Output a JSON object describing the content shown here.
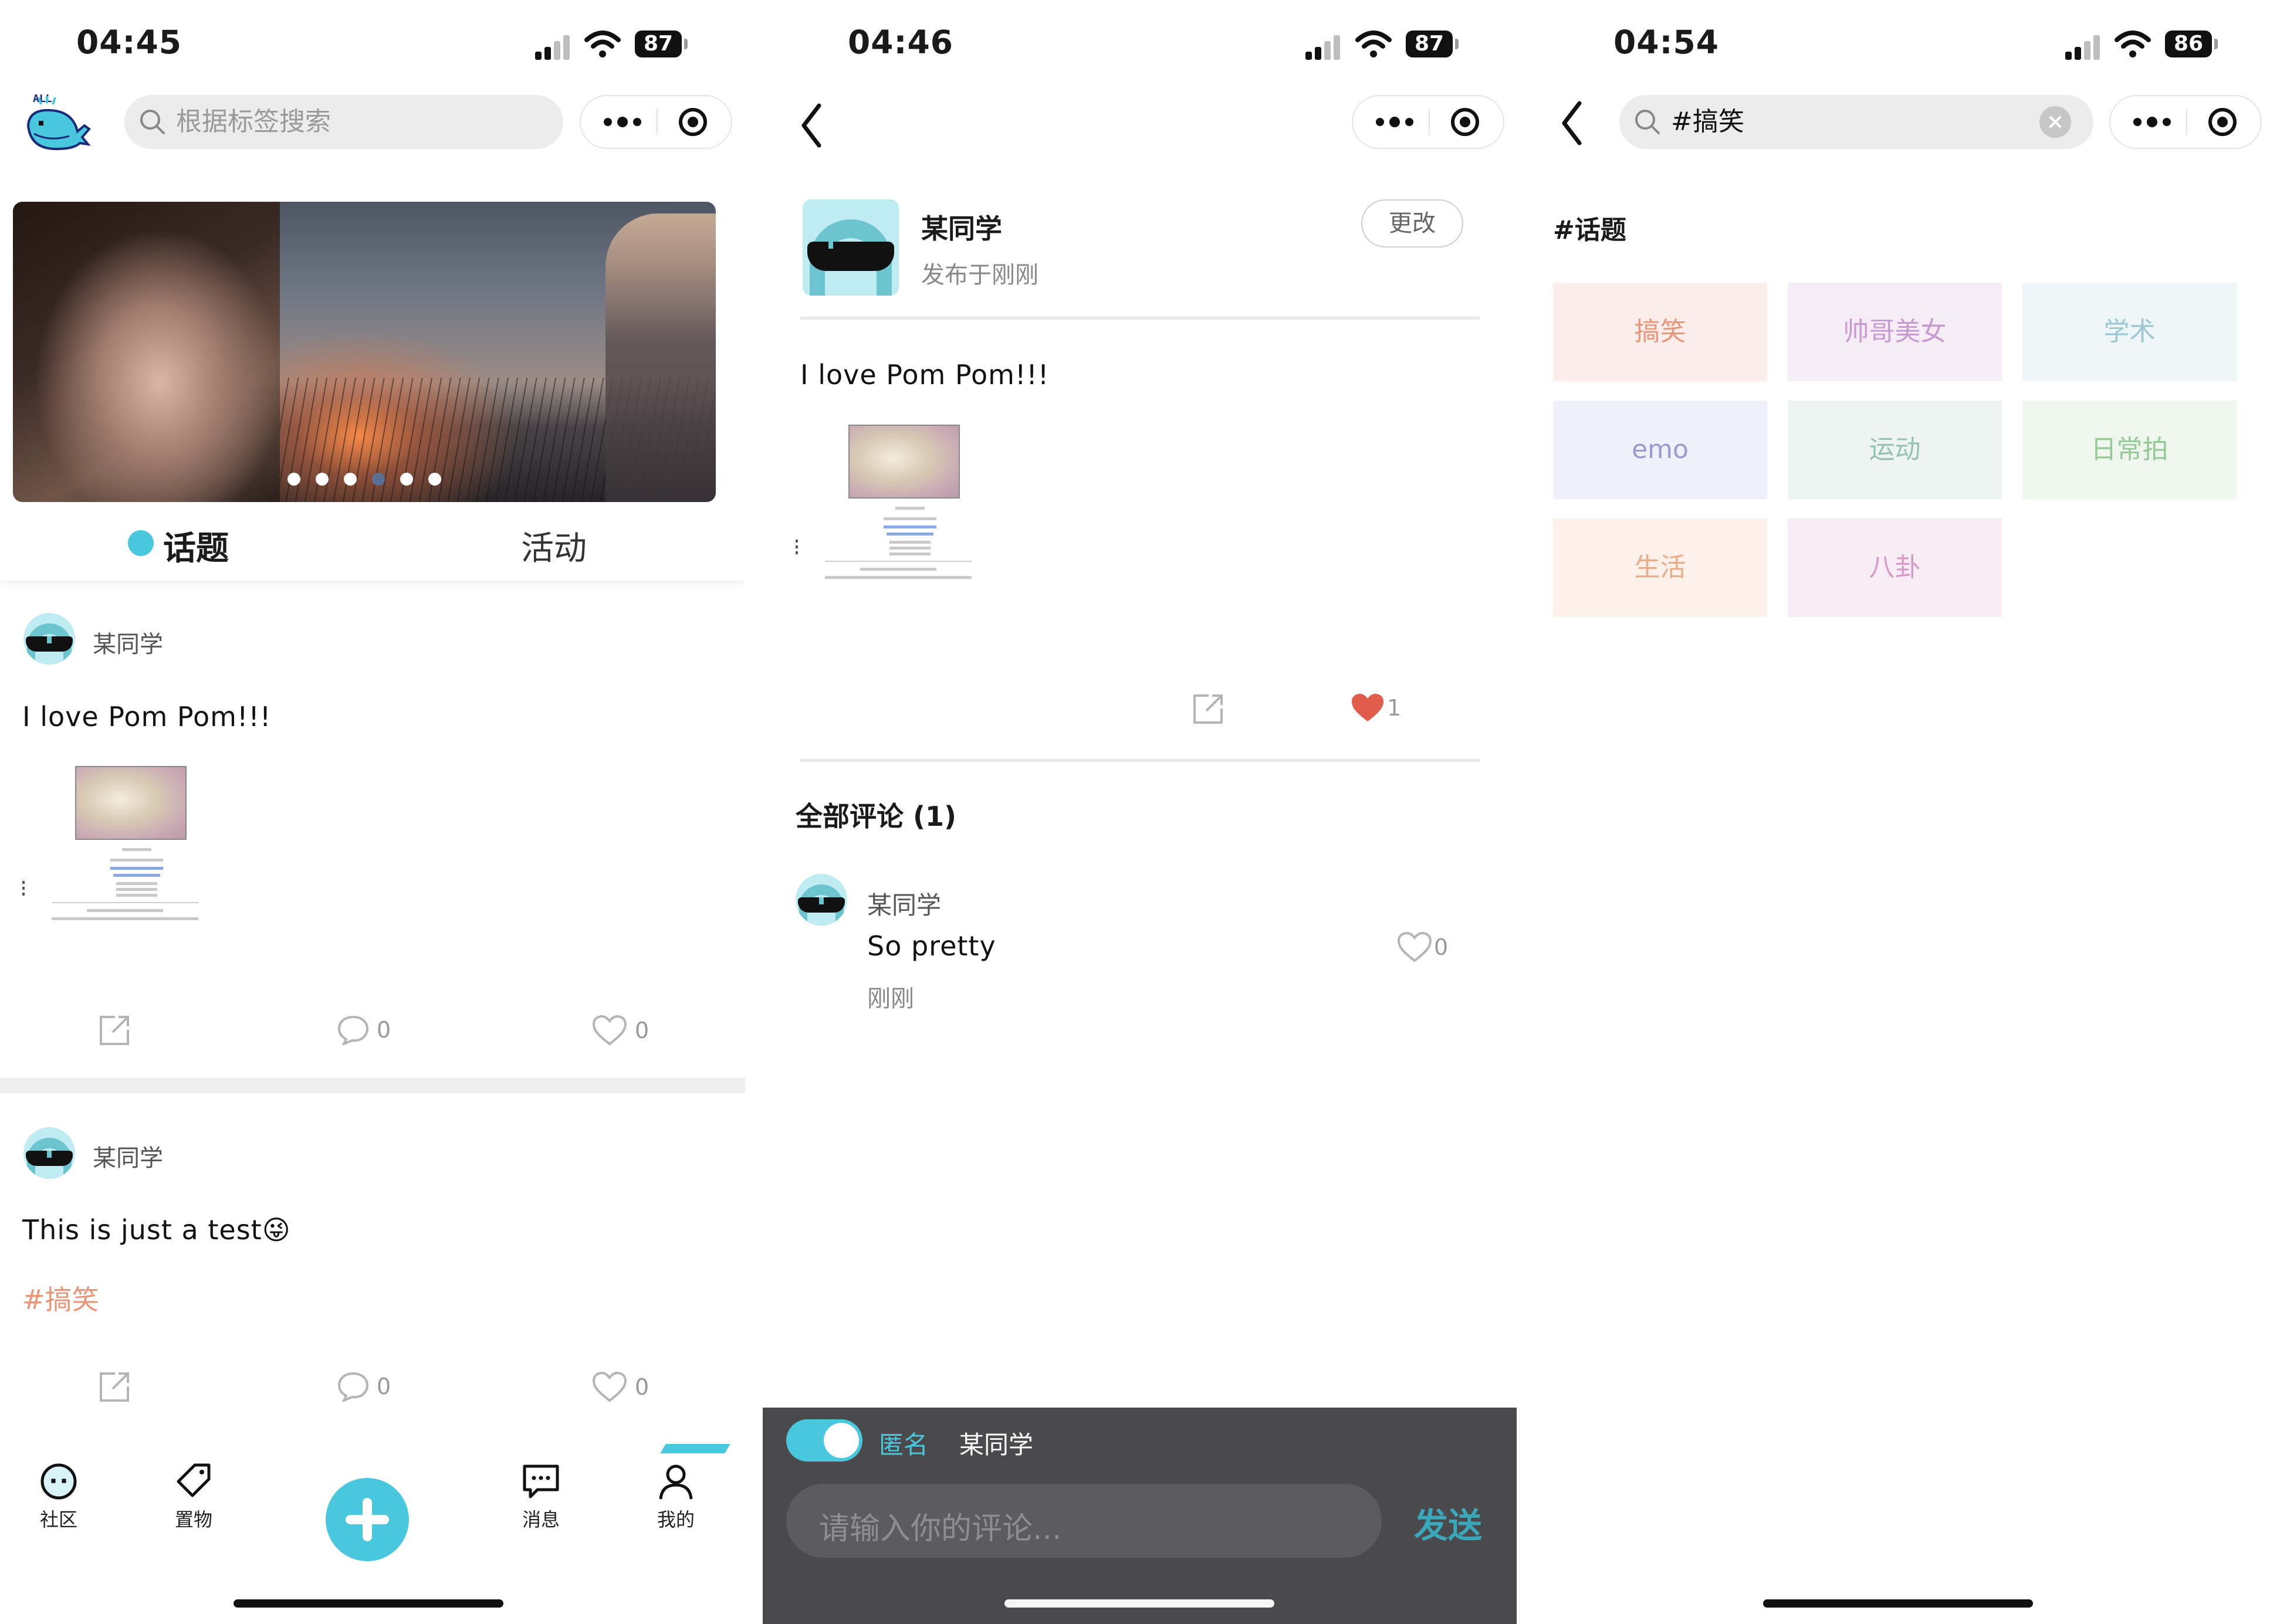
{
  "colors": {
    "accent": "#49c7dc",
    "tag": "#e8967a",
    "heart": "#e05d4b"
  },
  "screen1": {
    "status": {
      "time": "04:45",
      "battery": "87"
    },
    "search_placeholder": "根据标签搜索",
    "tabs": [
      "话题",
      "活动"
    ],
    "posts": [
      {
        "author": "某同学",
        "text": "I love Pom Pom!!!",
        "comments": "0",
        "likes": "0"
      },
      {
        "author": "某同学",
        "text": "This is just a test😜",
        "tag": "#搞笑",
        "comments": "0",
        "likes": "0"
      }
    ],
    "tabbar": [
      {
        "label": "社区",
        "icon": "community-icon"
      },
      {
        "label": "置物",
        "icon": "tag-icon"
      },
      {
        "label": "消息",
        "icon": "message-icon"
      },
      {
        "label": "我的",
        "icon": "profile-icon"
      }
    ]
  },
  "screen2": {
    "status": {
      "time": "04:46",
      "battery": "87"
    },
    "author": "某同学",
    "published": "发布于刚刚",
    "edit_label": "更改",
    "text": "I love Pom Pom!!!",
    "likes": "1",
    "comments_title": "全部评论 (1)",
    "comment": {
      "author": "某同学",
      "text": "So pretty",
      "time": "刚刚",
      "likes": "0"
    },
    "composer": {
      "anonymous_label": "匿名",
      "name": "某同学",
      "placeholder": "请输入你的评论...",
      "send_label": "发送"
    }
  },
  "screen3": {
    "status": {
      "time": "04:54",
      "battery": "86"
    },
    "search_value": "#搞笑",
    "section_title": "#话题",
    "tags": [
      {
        "label": "搞笑",
        "bg": "#fbeeea",
        "color": "#e8967a"
      },
      {
        "label": "帅哥美女",
        "bg": "#f6ecf6",
        "color": "#c79ad1"
      },
      {
        "label": "学术",
        "bg": "#edf5f7",
        "color": "#9cc7d3"
      },
      {
        "label": "emo",
        "bg": "#eff0fa",
        "color": "#9a9ad1"
      },
      {
        "label": "运动",
        "bg": "#edf4f1",
        "color": "#95c2b5"
      },
      {
        "label": "日常拍",
        "bg": "#eef6ee",
        "color": "#95c995"
      },
      {
        "label": "生活",
        "bg": "#fbf1ea",
        "color": "#e8ad87"
      },
      {
        "label": "八卦",
        "bg": "#f8ecf5",
        "color": "#d69ac8"
      }
    ]
  }
}
